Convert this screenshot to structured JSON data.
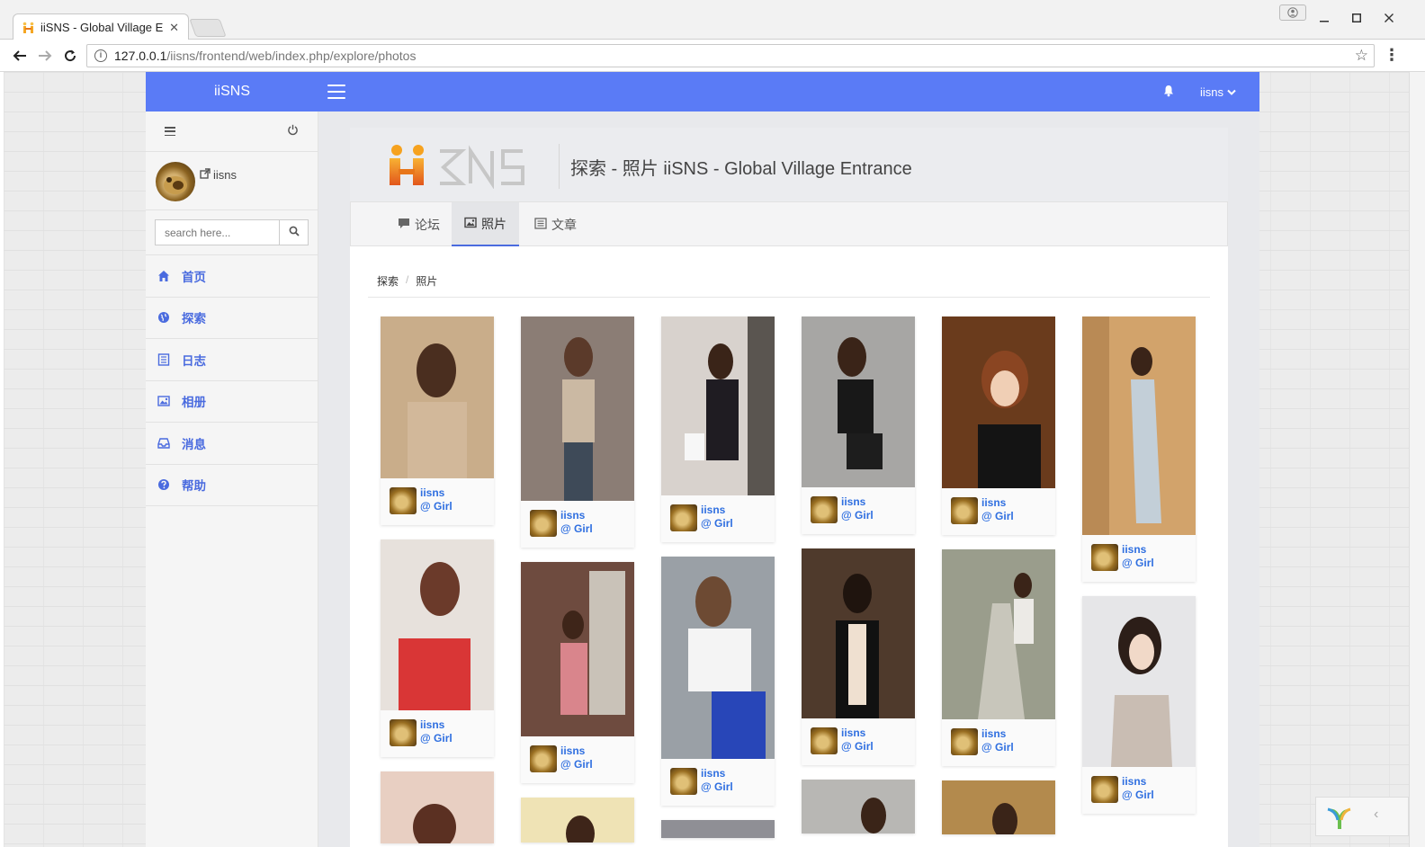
{
  "browser": {
    "tab_title": "iiSNS - Global Village En",
    "url_host": "127.0.0.1",
    "url_path": "/iisns/frontend/web/index.php/explore/photos"
  },
  "header": {
    "brand": "iiSNS",
    "user": "iisns",
    "accent_color": "#5a7bf6"
  },
  "sidebar": {
    "username": "iisns",
    "search_placeholder": "search here...",
    "items": [
      {
        "label": "首页",
        "icon": "home-icon"
      },
      {
        "label": "探索",
        "icon": "globe-icon"
      },
      {
        "label": "日志",
        "icon": "list-icon"
      },
      {
        "label": "相册",
        "icon": "picture-icon"
      },
      {
        "label": "消息",
        "icon": "inbox-icon"
      },
      {
        "label": "帮助",
        "icon": "question-circle-icon"
      }
    ]
  },
  "main": {
    "title": "探索 - 照片 iiSNS - Global Village Entrance",
    "tabs": [
      {
        "label": "论坛",
        "icon": "comment-icon"
      },
      {
        "label": "照片",
        "icon": "picture-icon",
        "active": true
      },
      {
        "label": "文章",
        "icon": "list-alt-icon"
      }
    ],
    "breadcrumb": [
      "探索",
      "照片"
    ]
  },
  "photos": {
    "author": "iisns",
    "album": "@ Girl"
  }
}
